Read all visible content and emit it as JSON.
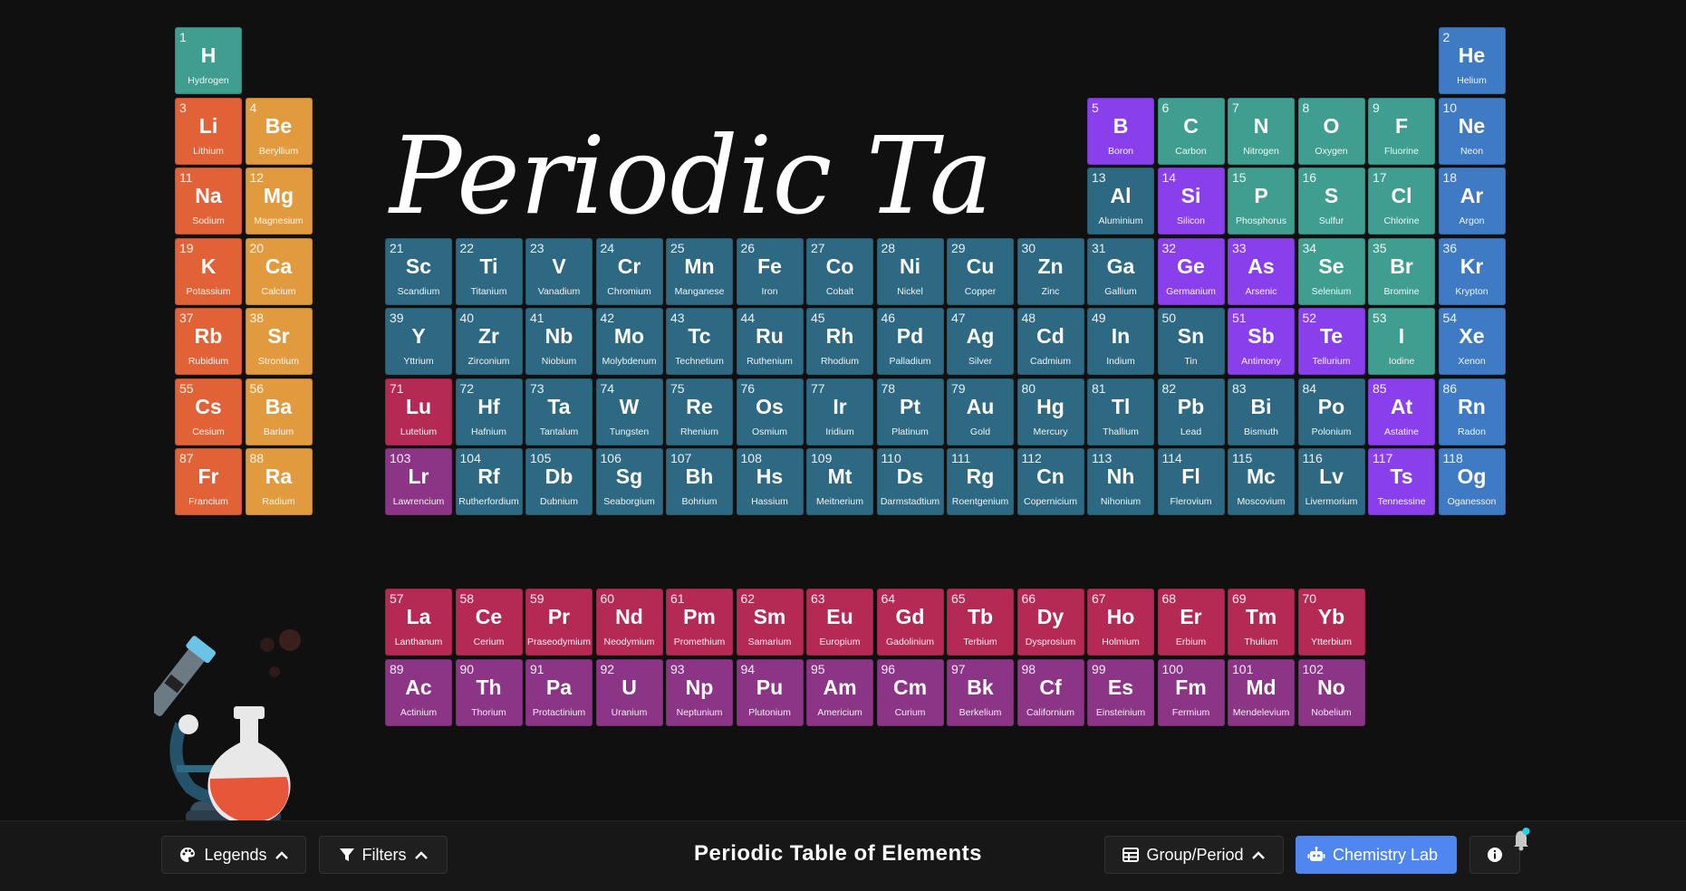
{
  "title_script": "Periodic Table",
  "footer": {
    "title": "Periodic Table of Elements",
    "legends_label": "Legends",
    "filters_label": "Filters",
    "groupperiod_label": "Group/Period",
    "lab_label": "Chemistry Lab"
  },
  "colors": {
    "alkali": "#e06236",
    "alkaline": "#e29a3e",
    "transition": "#2e6983",
    "metalloid": "#8a3fec",
    "nonmetal": "#3f9e90",
    "noble": "#3f7bc5",
    "lanthanide": "#b52a55",
    "actinide": "#8c3586",
    "accent": "#4f86f0"
  },
  "elements": [
    {
      "n": "1",
      "s": "H",
      "name": "Hydrogen",
      "cat": "nonmetal",
      "g": 1,
      "p": 1
    },
    {
      "n": "2",
      "s": "He",
      "name": "Helium",
      "cat": "noble",
      "g": 18,
      "p": 1
    },
    {
      "n": "3",
      "s": "Li",
      "name": "Lithium",
      "cat": "alkali",
      "g": 1,
      "p": 2
    },
    {
      "n": "4",
      "s": "Be",
      "name": "Beryllium",
      "cat": "alkaline",
      "g": 2,
      "p": 2
    },
    {
      "n": "5",
      "s": "B",
      "name": "Boron",
      "cat": "metalloid",
      "g": 13,
      "p": 2
    },
    {
      "n": "6",
      "s": "C",
      "name": "Carbon",
      "cat": "nonmetal",
      "g": 14,
      "p": 2
    },
    {
      "n": "7",
      "s": "N",
      "name": "Nitrogen",
      "cat": "nonmetal",
      "g": 15,
      "p": 2
    },
    {
      "n": "8",
      "s": "O",
      "name": "Oxygen",
      "cat": "nonmetal",
      "g": 16,
      "p": 2
    },
    {
      "n": "9",
      "s": "F",
      "name": "Fluorine",
      "cat": "nonmetal",
      "g": 17,
      "p": 2
    },
    {
      "n": "10",
      "s": "Ne",
      "name": "Neon",
      "cat": "noble",
      "g": 18,
      "p": 2
    },
    {
      "n": "11",
      "s": "Na",
      "name": "Sodium",
      "cat": "alkali",
      "g": 1,
      "p": 3
    },
    {
      "n": "12",
      "s": "Mg",
      "name": "Magnesium",
      "cat": "alkaline",
      "g": 2,
      "p": 3
    },
    {
      "n": "13",
      "s": "Al",
      "name": "Aluminium",
      "cat": "transition",
      "g": 13,
      "p": 3
    },
    {
      "n": "14",
      "s": "Si",
      "name": "Silicon",
      "cat": "metalloid",
      "g": 14,
      "p": 3
    },
    {
      "n": "15",
      "s": "P",
      "name": "Phosphorus",
      "cat": "nonmetal",
      "g": 15,
      "p": 3
    },
    {
      "n": "16",
      "s": "S",
      "name": "Sulfur",
      "cat": "nonmetal",
      "g": 16,
      "p": 3
    },
    {
      "n": "17",
      "s": "Cl",
      "name": "Chlorine",
      "cat": "nonmetal",
      "g": 17,
      "p": 3
    },
    {
      "n": "18",
      "s": "Ar",
      "name": "Argon",
      "cat": "noble",
      "g": 18,
      "p": 3
    },
    {
      "n": "19",
      "s": "K",
      "name": "Potassium",
      "cat": "alkali",
      "g": 1,
      "p": 4
    },
    {
      "n": "20",
      "s": "Ca",
      "name": "Calcium",
      "cat": "alkaline",
      "g": 2,
      "p": 4
    },
    {
      "n": "21",
      "s": "Sc",
      "name": "Scandium",
      "cat": "transition",
      "g": 3,
      "p": 4
    },
    {
      "n": "22",
      "s": "Ti",
      "name": "Titanium",
      "cat": "transition",
      "g": 4,
      "p": 4
    },
    {
      "n": "23",
      "s": "V",
      "name": "Vanadium",
      "cat": "transition",
      "g": 5,
      "p": 4
    },
    {
      "n": "24",
      "s": "Cr",
      "name": "Chromium",
      "cat": "transition",
      "g": 6,
      "p": 4
    },
    {
      "n": "25",
      "s": "Mn",
      "name": "Manganese",
      "cat": "transition",
      "g": 7,
      "p": 4
    },
    {
      "n": "26",
      "s": "Fe",
      "name": "Iron",
      "cat": "transition",
      "g": 8,
      "p": 4
    },
    {
      "n": "27",
      "s": "Co",
      "name": "Cobalt",
      "cat": "transition",
      "g": 9,
      "p": 4
    },
    {
      "n": "28",
      "s": "Ni",
      "name": "Nickel",
      "cat": "transition",
      "g": 10,
      "p": 4
    },
    {
      "n": "29",
      "s": "Cu",
      "name": "Copper",
      "cat": "transition",
      "g": 11,
      "p": 4
    },
    {
      "n": "30",
      "s": "Zn",
      "name": "Zinc",
      "cat": "transition",
      "g": 12,
      "p": 4
    },
    {
      "n": "31",
      "s": "Ga",
      "name": "Gallium",
      "cat": "transition",
      "g": 13,
      "p": 4
    },
    {
      "n": "32",
      "s": "Ge",
      "name": "Germanium",
      "cat": "metalloid",
      "g": 14,
      "p": 4
    },
    {
      "n": "33",
      "s": "As",
      "name": "Arsenic",
      "cat": "metalloid",
      "g": 15,
      "p": 4
    },
    {
      "n": "34",
      "s": "Se",
      "name": "Selenium",
      "cat": "nonmetal",
      "g": 16,
      "p": 4
    },
    {
      "n": "35",
      "s": "Br",
      "name": "Bromine",
      "cat": "nonmetal",
      "g": 17,
      "p": 4
    },
    {
      "n": "36",
      "s": "Kr",
      "name": "Krypton",
      "cat": "noble",
      "g": 18,
      "p": 4
    },
    {
      "n": "37",
      "s": "Rb",
      "name": "Rubidium",
      "cat": "alkali",
      "g": 1,
      "p": 5
    },
    {
      "n": "38",
      "s": "Sr",
      "name": "Strontium",
      "cat": "alkaline",
      "g": 2,
      "p": 5
    },
    {
      "n": "39",
      "s": "Y",
      "name": "Yttrium",
      "cat": "transition",
      "g": 3,
      "p": 5
    },
    {
      "n": "40",
      "s": "Zr",
      "name": "Zirconium",
      "cat": "transition",
      "g": 4,
      "p": 5
    },
    {
      "n": "41",
      "s": "Nb",
      "name": "Niobium",
      "cat": "transition",
      "g": 5,
      "p": 5
    },
    {
      "n": "42",
      "s": "Mo",
      "name": "Molybdenum",
      "cat": "transition",
      "g": 6,
      "p": 5
    },
    {
      "n": "43",
      "s": "Tc",
      "name": "Technetium",
      "cat": "transition",
      "g": 7,
      "p": 5
    },
    {
      "n": "44",
      "s": "Ru",
      "name": "Ruthenium",
      "cat": "transition",
      "g": 8,
      "p": 5
    },
    {
      "n": "45",
      "s": "Rh",
      "name": "Rhodium",
      "cat": "transition",
      "g": 9,
      "p": 5
    },
    {
      "n": "46",
      "s": "Pd",
      "name": "Palladium",
      "cat": "transition",
      "g": 10,
      "p": 5
    },
    {
      "n": "47",
      "s": "Ag",
      "name": "Silver",
      "cat": "transition",
      "g": 11,
      "p": 5
    },
    {
      "n": "48",
      "s": "Cd",
      "name": "Cadmium",
      "cat": "transition",
      "g": 12,
      "p": 5
    },
    {
      "n": "49",
      "s": "In",
      "name": "Indium",
      "cat": "transition",
      "g": 13,
      "p": 5
    },
    {
      "n": "50",
      "s": "Sn",
      "name": "Tin",
      "cat": "transition",
      "g": 14,
      "p": 5
    },
    {
      "n": "51",
      "s": "Sb",
      "name": "Antimony",
      "cat": "metalloid",
      "g": 15,
      "p": 5
    },
    {
      "n": "52",
      "s": "Te",
      "name": "Tellurium",
      "cat": "metalloid",
      "g": 16,
      "p": 5
    },
    {
      "n": "53",
      "s": "I",
      "name": "Iodine",
      "cat": "nonmetal",
      "g": 17,
      "p": 5
    },
    {
      "n": "54",
      "s": "Xe",
      "name": "Xenon",
      "cat": "noble",
      "g": 18,
      "p": 5
    },
    {
      "n": "55",
      "s": "Cs",
      "name": "Cesium",
      "cat": "alkali",
      "g": 1,
      "p": 6
    },
    {
      "n": "56",
      "s": "Ba",
      "name": "Barium",
      "cat": "alkaline",
      "g": 2,
      "p": 6
    },
    {
      "n": "71",
      "s": "Lu",
      "name": "Lutetium",
      "cat": "lanthanide",
      "g": 3,
      "p": 6
    },
    {
      "n": "72",
      "s": "Hf",
      "name": "Hafnium",
      "cat": "transition",
      "g": 4,
      "p": 6
    },
    {
      "n": "73",
      "s": "Ta",
      "name": "Tantalum",
      "cat": "transition",
      "g": 5,
      "p": 6
    },
    {
      "n": "74",
      "s": "W",
      "name": "Tungsten",
      "cat": "transition",
      "g": 6,
      "p": 6
    },
    {
      "n": "75",
      "s": "Re",
      "name": "Rhenium",
      "cat": "transition",
      "g": 7,
      "p": 6
    },
    {
      "n": "76",
      "s": "Os",
      "name": "Osmium",
      "cat": "transition",
      "g": 8,
      "p": 6
    },
    {
      "n": "77",
      "s": "Ir",
      "name": "Iridium",
      "cat": "transition",
      "g": 9,
      "p": 6
    },
    {
      "n": "78",
      "s": "Pt",
      "name": "Platinum",
      "cat": "transition",
      "g": 10,
      "p": 6
    },
    {
      "n": "79",
      "s": "Au",
      "name": "Gold",
      "cat": "transition",
      "g": 11,
      "p": 6
    },
    {
      "n": "80",
      "s": "Hg",
      "name": "Mercury",
      "cat": "transition",
      "g": 12,
      "p": 6
    },
    {
      "n": "81",
      "s": "Tl",
      "name": "Thallium",
      "cat": "transition",
      "g": 13,
      "p": 6
    },
    {
      "n": "82",
      "s": "Pb",
      "name": "Lead",
      "cat": "transition",
      "g": 14,
      "p": 6
    },
    {
      "n": "83",
      "s": "Bi",
      "name": "Bismuth",
      "cat": "transition",
      "g": 15,
      "p": 6
    },
    {
      "n": "84",
      "s": "Po",
      "name": "Polonium",
      "cat": "transition",
      "g": 16,
      "p": 6
    },
    {
      "n": "85",
      "s": "At",
      "name": "Astatine",
      "cat": "metalloid",
      "g": 17,
      "p": 6
    },
    {
      "n": "86",
      "s": "Rn",
      "name": "Radon",
      "cat": "noble",
      "g": 18,
      "p": 6
    },
    {
      "n": "87",
      "s": "Fr",
      "name": "Francium",
      "cat": "alkali",
      "g": 1,
      "p": 7
    },
    {
      "n": "88",
      "s": "Ra",
      "name": "Radium",
      "cat": "alkaline",
      "g": 2,
      "p": 7
    },
    {
      "n": "103",
      "s": "Lr",
      "name": "Lawrencium",
      "cat": "actinide",
      "g": 3,
      "p": 7
    },
    {
      "n": "104",
      "s": "Rf",
      "name": "Rutherfordium",
      "cat": "transition",
      "g": 4,
      "p": 7
    },
    {
      "n": "105",
      "s": "Db",
      "name": "Dubnium",
      "cat": "transition",
      "g": 5,
      "p": 7
    },
    {
      "n": "106",
      "s": "Sg",
      "name": "Seaborgium",
      "cat": "transition",
      "g": 6,
      "p": 7
    },
    {
      "n": "107",
      "s": "Bh",
      "name": "Bohrium",
      "cat": "transition",
      "g": 7,
      "p": 7
    },
    {
      "n": "108",
      "s": "Hs",
      "name": "Hassium",
      "cat": "transition",
      "g": 8,
      "p": 7
    },
    {
      "n": "109",
      "s": "Mt",
      "name": "Meitnerium",
      "cat": "transition",
      "g": 9,
      "p": 7
    },
    {
      "n": "110",
      "s": "Ds",
      "name": "Darmstadtium",
      "cat": "transition",
      "g": 10,
      "p": 7
    },
    {
      "n": "111",
      "s": "Rg",
      "name": "Roentgenium",
      "cat": "transition",
      "g": 11,
      "p": 7
    },
    {
      "n": "112",
      "s": "Cn",
      "name": "Copernicium",
      "cat": "transition",
      "g": 12,
      "p": 7
    },
    {
      "n": "113",
      "s": "Nh",
      "name": "Nihonium",
      "cat": "transition",
      "g": 13,
      "p": 7
    },
    {
      "n": "114",
      "s": "Fl",
      "name": "Flerovium",
      "cat": "transition",
      "g": 14,
      "p": 7
    },
    {
      "n": "115",
      "s": "Mc",
      "name": "Moscovium",
      "cat": "transition",
      "g": 15,
      "p": 7
    },
    {
      "n": "116",
      "s": "Lv",
      "name": "Livermorium",
      "cat": "transition",
      "g": 16,
      "p": 7
    },
    {
      "n": "117",
      "s": "Ts",
      "name": "Tennessine",
      "cat": "metalloid",
      "g": 17,
      "p": 7
    },
    {
      "n": "118",
      "s": "Og",
      "name": "Oganesson",
      "cat": "noble",
      "g": 18,
      "p": 7
    },
    {
      "n": "57",
      "s": "La",
      "name": "Lanthanum",
      "cat": "lanthanide",
      "g": 3,
      "p": 9
    },
    {
      "n": "58",
      "s": "Ce",
      "name": "Cerium",
      "cat": "lanthanide",
      "g": 4,
      "p": 9
    },
    {
      "n": "59",
      "s": "Pr",
      "name": "Praseodymium",
      "cat": "lanthanide",
      "g": 5,
      "p": 9
    },
    {
      "n": "60",
      "s": "Nd",
      "name": "Neodymium",
      "cat": "lanthanide",
      "g": 6,
      "p": 9
    },
    {
      "n": "61",
      "s": "Pm",
      "name": "Promethium",
      "cat": "lanthanide",
      "g": 7,
      "p": 9
    },
    {
      "n": "62",
      "s": "Sm",
      "name": "Samarium",
      "cat": "lanthanide",
      "g": 8,
      "p": 9
    },
    {
      "n": "63",
      "s": "Eu",
      "name": "Europium",
      "cat": "lanthanide",
      "g": 9,
      "p": 9
    },
    {
      "n": "64",
      "s": "Gd",
      "name": "Gadolinium",
      "cat": "lanthanide",
      "g": 10,
      "p": 9
    },
    {
      "n": "65",
      "s": "Tb",
      "name": "Terbium",
      "cat": "lanthanide",
      "g": 11,
      "p": 9
    },
    {
      "n": "66",
      "s": "Dy",
      "name": "Dysprosium",
      "cat": "lanthanide",
      "g": 12,
      "p": 9
    },
    {
      "n": "67",
      "s": "Ho",
      "name": "Holmium",
      "cat": "lanthanide",
      "g": 13,
      "p": 9
    },
    {
      "n": "68",
      "s": "Er",
      "name": "Erbium",
      "cat": "lanthanide",
      "g": 14,
      "p": 9
    },
    {
      "n": "69",
      "s": "Tm",
      "name": "Thulium",
      "cat": "lanthanide",
      "g": 15,
      "p": 9
    },
    {
      "n": "70",
      "s": "Yb",
      "name": "Ytterbium",
      "cat": "lanthanide",
      "g": 16,
      "p": 9
    },
    {
      "n": "89",
      "s": "Ac",
      "name": "Actinium",
      "cat": "actinide",
      "g": 3,
      "p": 10
    },
    {
      "n": "90",
      "s": "Th",
      "name": "Thorium",
      "cat": "actinide",
      "g": 4,
      "p": 10
    },
    {
      "n": "91",
      "s": "Pa",
      "name": "Protactinium",
      "cat": "actinide",
      "g": 5,
      "p": 10
    },
    {
      "n": "92",
      "s": "U",
      "name": "Uranium",
      "cat": "actinide",
      "g": 6,
      "p": 10
    },
    {
      "n": "93",
      "s": "Np",
      "name": "Neptunium",
      "cat": "actinide",
      "g": 7,
      "p": 10
    },
    {
      "n": "94",
      "s": "Pu",
      "name": "Plutonium",
      "cat": "actinide",
      "g": 8,
      "p": 10
    },
    {
      "n": "95",
      "s": "Am",
      "name": "Americium",
      "cat": "actinide",
      "g": 9,
      "p": 10
    },
    {
      "n": "96",
      "s": "Cm",
      "name": "Curium",
      "cat": "actinide",
      "g": 10,
      "p": 10
    },
    {
      "n": "97",
      "s": "Bk",
      "name": "Berkelium",
      "cat": "actinide",
      "g": 11,
      "p": 10
    },
    {
      "n": "98",
      "s": "Cf",
      "name": "Californium",
      "cat": "actinide",
      "g": 12,
      "p": 10
    },
    {
      "n": "99",
      "s": "Es",
      "name": "Einsteinium",
      "cat": "actinide",
      "g": 13,
      "p": 10
    },
    {
      "n": "100",
      "s": "Fm",
      "name": "Fermium",
      "cat": "actinide",
      "g": 14,
      "p": 10
    },
    {
      "n": "101",
      "s": "Md",
      "name": "Mendelevium",
      "cat": "actinide",
      "g": 15,
      "p": 10
    },
    {
      "n": "102",
      "s": "No",
      "name": "Nobelium",
      "cat": "actinide",
      "g": 16,
      "p": 10
    }
  ]
}
